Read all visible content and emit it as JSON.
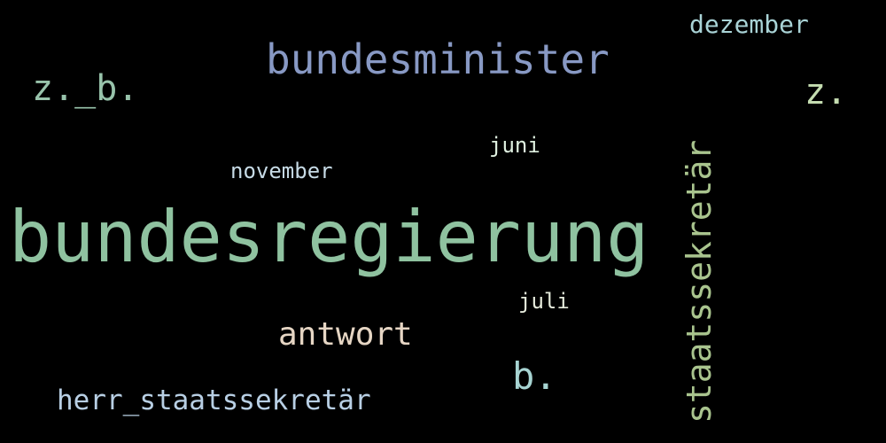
{
  "wordcloud": {
    "words": {
      "bundesregierung": {
        "text": "bundesregierung",
        "color": "#8fc2a0"
      },
      "bundesminister": {
        "text": "bundesminister",
        "color": "#8899c4"
      },
      "staatssekretaer": {
        "text": "staatssekretär",
        "color": "#a9c48e"
      },
      "zb": {
        "text": "z._b.",
        "color": "#98c3ab"
      },
      "z": {
        "text": "z.",
        "color": "#c4dcb0"
      },
      "dezember": {
        "text": "dezember",
        "color": "#a9d3d6"
      },
      "juni": {
        "text": "juni",
        "color": "#dff0e0"
      },
      "november": {
        "text": "november",
        "color": "#c7dbe6"
      },
      "antwort": {
        "text": "antwort",
        "color": "#e6d6c4"
      },
      "juli": {
        "text": "juli",
        "color": "#e5eadb"
      },
      "b": {
        "text": "b.",
        "color": "#a7d4d2"
      },
      "herr": {
        "text": "herr_staatssekretär",
        "color": "#b8cfe4"
      }
    }
  }
}
